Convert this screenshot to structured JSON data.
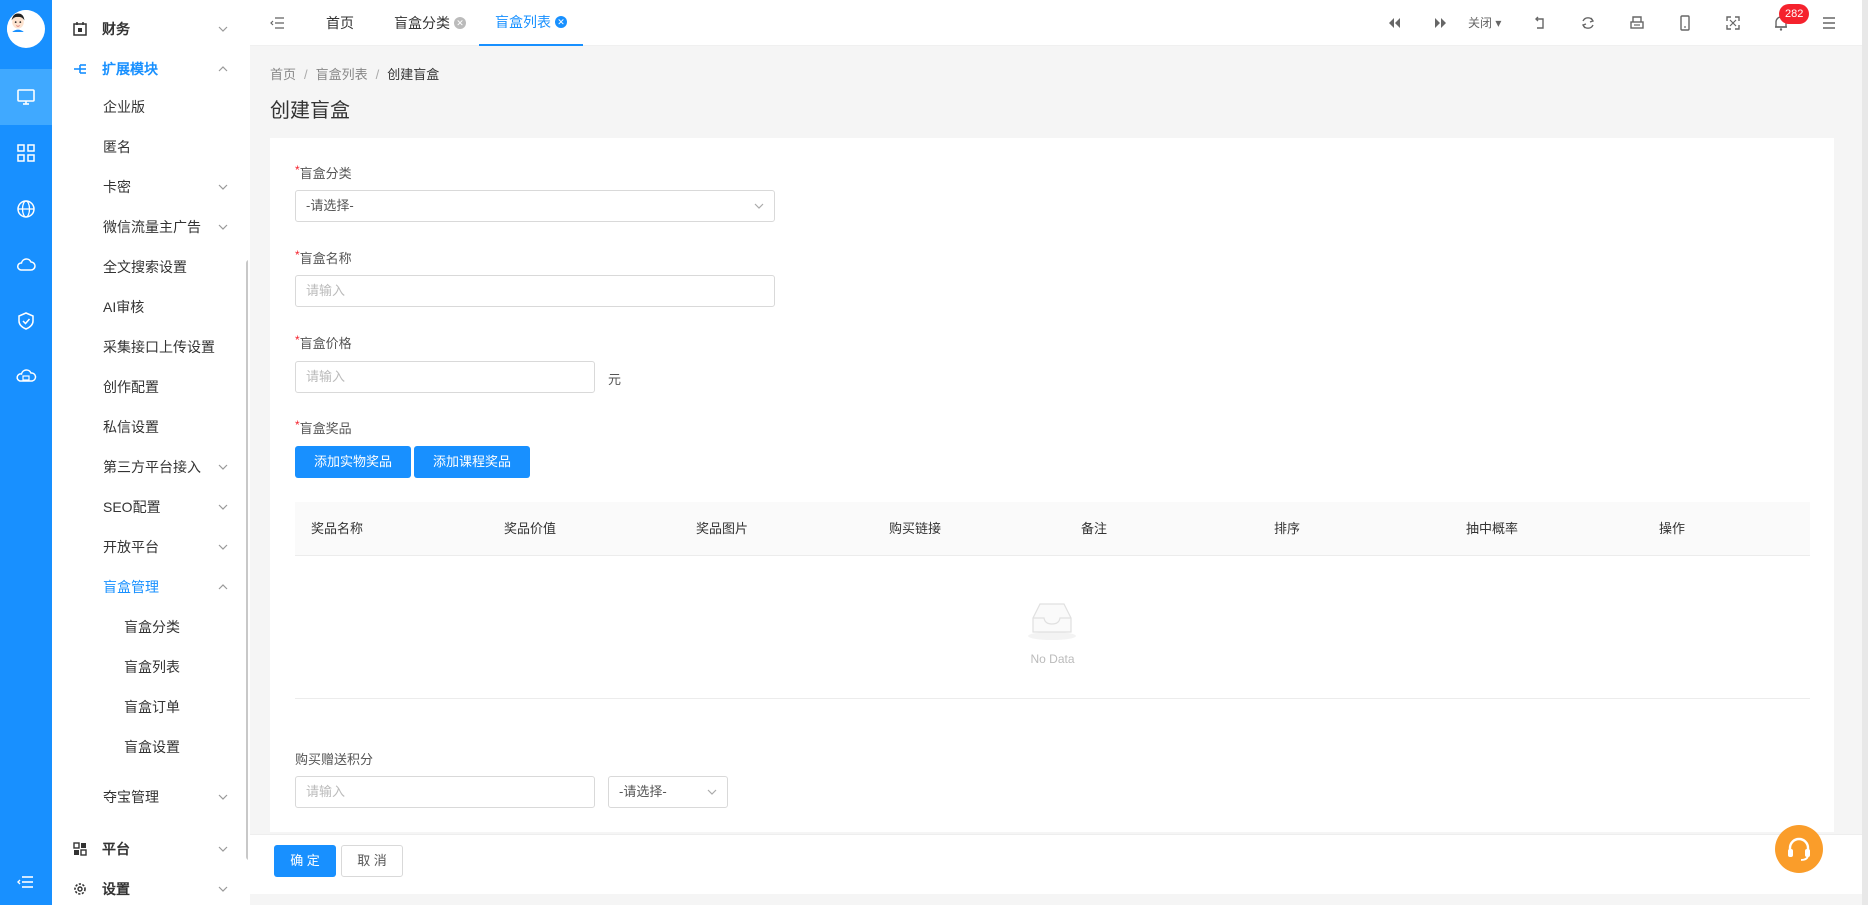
{
  "sidebar": {
    "finance": "财务",
    "ext_module": "扩展模块",
    "items": [
      "企业版",
      "匿名",
      "卡密",
      "微信流量主广告",
      "全文搜索设置",
      "AI审核",
      "采集接口上传设置",
      "创作配置",
      "私信设置",
      "第三方平台接入",
      "SEO配置",
      "开放平台",
      "盲盒管理"
    ],
    "blindbox_sub": [
      "盲盒分类",
      "盲盒列表",
      "盲盒订单",
      "盲盒设置"
    ],
    "treasure": "夺宝管理",
    "platform": "平台",
    "settings": "设置"
  },
  "tabs": {
    "home": "首页",
    "category": "盲盒分类",
    "list": "盲盒列表",
    "close_label": "关闭",
    "badge": "282"
  },
  "breadcrumb": {
    "home": "首页",
    "list": "盲盒列表",
    "current": "创建盲盒"
  },
  "page_title": "创建盲盒",
  "form": {
    "category_label": "盲盒分类",
    "category_value": "-请选择-",
    "name_label": "盲盒名称",
    "name_placeholder": "请输入",
    "price_label": "盲盒价格",
    "price_placeholder": "请输入",
    "price_unit": "元",
    "prize_label": "盲盒奖品",
    "add_physical": "添加实物奖品",
    "add_course": "添加课程奖品",
    "table_headers": [
      "奖品名称",
      "奖品价值",
      "奖品图片",
      "购买链接",
      "备注",
      "排序",
      "抽中概率",
      "操作"
    ],
    "empty_text": "No Data",
    "points_label": "购买赠送积分",
    "points_placeholder": "请输入",
    "points_select": "-请选择-"
  },
  "footer": {
    "confirm": "确 定",
    "cancel": "取 消"
  },
  "colors": {
    "primary": "#1890ff",
    "badge": "#f5222d",
    "service": "#fa9d2a"
  }
}
